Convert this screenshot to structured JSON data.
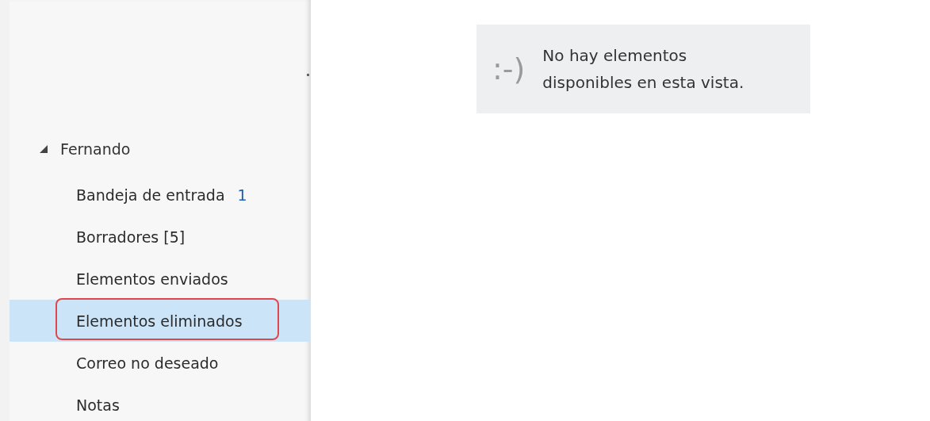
{
  "folder_tree": {
    "account": "Fernando",
    "expanded": true,
    "children": [
      {
        "name": "Bandeja de entrada",
        "count": "1",
        "selected": false,
        "highlighted": false
      },
      {
        "name": "Borradores [5]",
        "selected": false,
        "highlighted": false
      },
      {
        "name": "Elementos enviados",
        "selected": false,
        "highlighted": false
      },
      {
        "name": "Elementos eliminados",
        "selected": true,
        "highlighted": true
      },
      {
        "name": "Correo no deseado",
        "selected": false,
        "highlighted": false
      },
      {
        "name": "Notas",
        "selected": false,
        "highlighted": false
      }
    ]
  },
  "empty_message": {
    "emoticon": ":-)",
    "text": "No hay elementos disponibles en esta vista."
  }
}
